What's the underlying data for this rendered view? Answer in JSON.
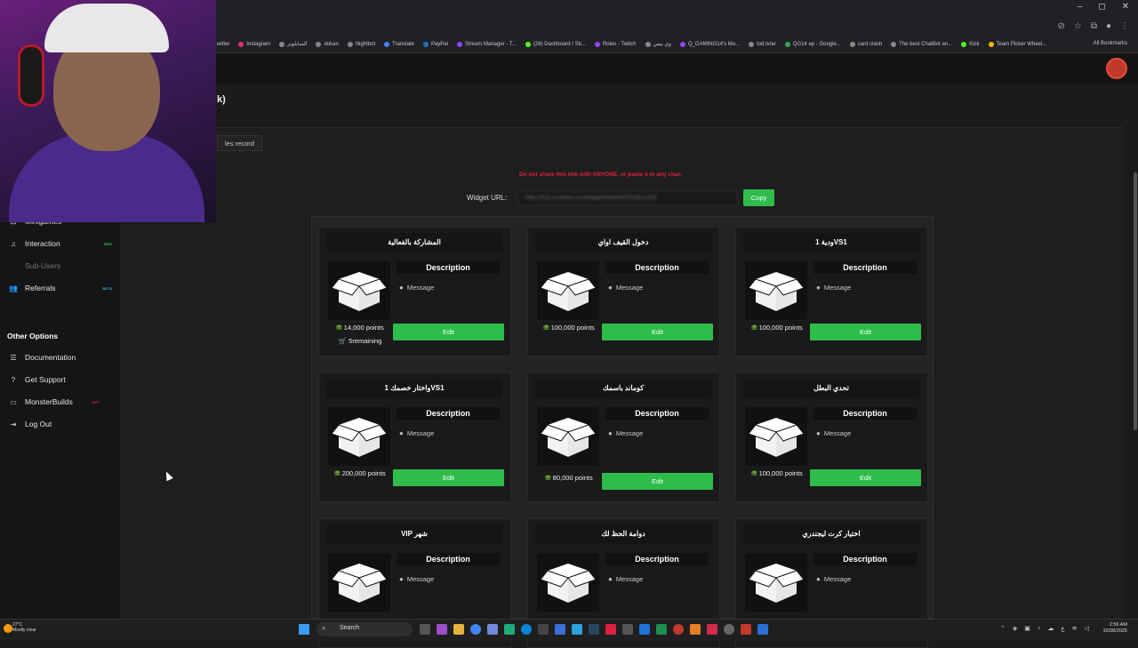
{
  "browser": {
    "bookmarks": [
      "witter",
      "Instagram",
      "السايلونز",
      "dokan",
      "Nightbot",
      "Translate",
      "PayPal",
      "Stream Manager - T...",
      "(28) Dashboard / Str...",
      "Roles - Twitch",
      "وي بيس",
      "Q_GAMING14's Mo...",
      "tod.tv/ar",
      "QG14 ep - Google...",
      "card clash",
      "The best ChatBot an...",
      "Kick",
      "Team Picker Wheel..."
    ],
    "all_bookmarks": "All Bookmarks",
    "win_controls": [
      "–",
      "◻",
      "✕"
    ]
  },
  "page": {
    "title_fragment": "k)",
    "tab_fragment": "les record"
  },
  "sidebar": {
    "items": [
      {
        "label": "Minigames",
        "icon": "gamepad-icon",
        "badge": ""
      },
      {
        "label": "Interaction",
        "icon": "music-icon",
        "badge": "NEW"
      },
      {
        "label": "Sub-Users",
        "icon": "users-icon",
        "badge": ""
      },
      {
        "label": "Referrals",
        "icon": "referrals-icon",
        "badge": "BETA"
      }
    ],
    "other_heading": "Other Options",
    "other_items": [
      {
        "label": "Documentation",
        "icon": "list-icon",
        "badge": ""
      },
      {
        "label": "Get Support",
        "icon": "help-icon",
        "badge": ""
      },
      {
        "label": "MonsterBuilds",
        "icon": "monitor-icon",
        "badge": "HOT"
      },
      {
        "label": "Log Out",
        "icon": "logout-icon",
        "badge": ""
      }
    ]
  },
  "widget": {
    "warning": "Do not share this link with ANYONE, or paste it in any chat.",
    "label": "Widget URL:",
    "url": "https://kick.onrender.com/widget/redeem/d7f2a5b1c93e",
    "copy": "Copy"
  },
  "cards": [
    {
      "title": "المشاركة بالفعالية",
      "desc": "Description",
      "message": "Message",
      "points": "14,000 points",
      "remaining": "5remaining",
      "edit": "Edit"
    },
    {
      "title": "دخول القيف اواي",
      "desc": "Description",
      "message": "Message",
      "points": "100,000 points",
      "remaining": "",
      "edit": "Edit"
    },
    {
      "title": "ودية 1VS1",
      "desc": "Description",
      "message": "Message",
      "points": "100,000 points",
      "remaining": "",
      "edit": "Edit"
    },
    {
      "title": "واختار خصمك 1VS1",
      "desc": "Description",
      "message": "Message",
      "points": "200,000 points",
      "remaining": "",
      "edit": "Edit"
    },
    {
      "title": "كوماند باسمك",
      "desc": "Description",
      "message": "Message",
      "points": "80,000 points",
      "remaining": "",
      "edit": "Edit"
    },
    {
      "title": "تحدي البطل",
      "desc": "Description",
      "message": "Message",
      "points": "100,000 points",
      "remaining": "",
      "edit": "Edit"
    },
    {
      "title": "VIP شهر",
      "desc": "Description",
      "message": "Message",
      "points": "",
      "remaining": "",
      "edit": "Edit"
    },
    {
      "title": "دوامة الحظ لك",
      "desc": "Description",
      "message": "Message",
      "points": "",
      "remaining": "",
      "edit": "Edit"
    },
    {
      "title": "اختيار كرت ليجندري",
      "desc": "Description",
      "message": "Message",
      "points": "",
      "remaining": "",
      "edit": "Edit"
    }
  ],
  "taskbar": {
    "temp": "27°C",
    "weather": "Mostly clear",
    "search": "Search",
    "time": "2:56 AM",
    "date": "10/28/2025"
  },
  "colors": {
    "accent_green": "#2ebd4a",
    "warning_red": "#e02040"
  }
}
